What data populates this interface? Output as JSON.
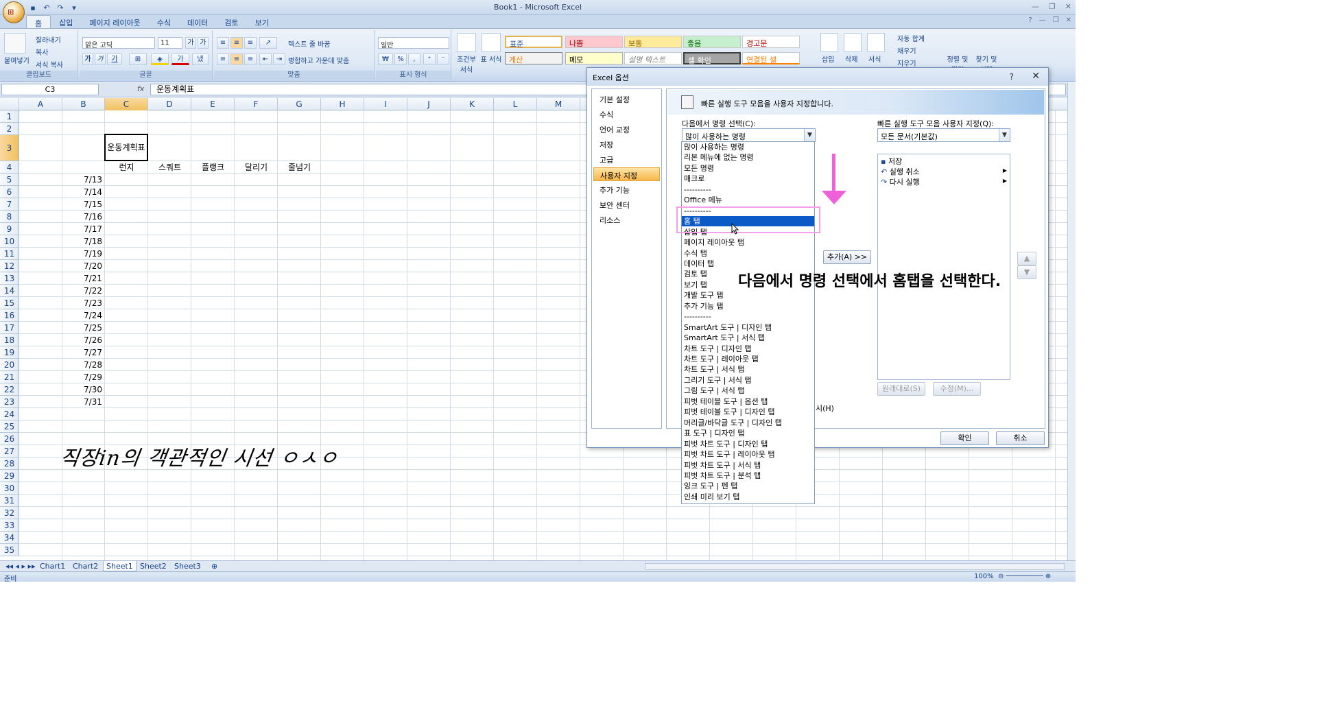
{
  "window": {
    "title": "Book1 - Microsoft Excel"
  },
  "office_button": {
    "label": "Office"
  },
  "ribbon_tabs": [
    "홈",
    "삽입",
    "페이지 레이아웃",
    "수식",
    "데이터",
    "검토",
    "보기"
  ],
  "clipboard": {
    "paste": "붙여넣기",
    "cut": "잘라내기",
    "copy": "복사",
    "format_painter": "서식 복사",
    "label": "클립보드"
  },
  "font": {
    "name": "맑은 고딕",
    "size": "11",
    "label": "글꼴"
  },
  "alignment": {
    "wrap": "텍스트 줄 바꿈",
    "merge": "병합하고 가운데 맞춤",
    "label": "맞춤"
  },
  "number": {
    "format": "일반",
    "label": "표시 형식"
  },
  "styles": {
    "conditional": "조건부 서식",
    "table": "표 서식",
    "cells": [
      "표준",
      "나쁨",
      "보통",
      "좋음",
      "경고문",
      "계산",
      "메모",
      "설명 텍스트",
      "셀 확인",
      "연결된 셀"
    ]
  },
  "cells_group": {
    "insert": "삽입",
    "delete": "삭제",
    "format": "서식"
  },
  "editing": {
    "autosum": "자동 합계",
    "fill": "채우기",
    "clear": "지우기",
    "sort": "정렬 및 필터",
    "find": "찾기 및 선택"
  },
  "formula_bar": {
    "name_box": "C3",
    "fx": "fx",
    "content": "운동계획표"
  },
  "columns": [
    "A",
    "B",
    "C",
    "D",
    "E",
    "F",
    "G",
    "H",
    "I",
    "J",
    "K",
    "L",
    "M"
  ],
  "rows": [
    "1",
    "2",
    "3",
    "4",
    "5",
    "6",
    "7",
    "8",
    "9",
    "10",
    "11",
    "12",
    "13",
    "14",
    "15",
    "16",
    "17",
    "18",
    "19",
    "20",
    "21",
    "22",
    "23",
    "24",
    "25",
    "26",
    "27",
    "28",
    "29",
    "30",
    "31",
    "32",
    "33",
    "34",
    "35"
  ],
  "sheet": {
    "title_cell": "운동계획표",
    "headers": [
      "런지",
      "스쿼트",
      "플랭크",
      "달리기",
      "줄넘기"
    ],
    "dates": [
      "7/13",
      "7/14",
      "7/15",
      "7/16",
      "7/17",
      "7/18",
      "7/19",
      "7/20",
      "7/21",
      "7/22",
      "7/23",
      "7/24",
      "7/25",
      "7/26",
      "7/27",
      "7/28",
      "7/29",
      "7/30",
      "7/31"
    ]
  },
  "sheet_tabs": [
    "Chart1",
    "Chart2",
    "Sheet1",
    "Sheet2",
    "Sheet3"
  ],
  "status": {
    "ready": "준비",
    "zoom": "100%"
  },
  "dialog": {
    "title": "Excel 옵션",
    "help": "?",
    "nav": [
      "기본 설정",
      "수식",
      "언어 교정",
      "저장",
      "고급",
      "사용자 지정",
      "추가 기능",
      "보안 센터",
      "리소스"
    ],
    "header": "빠른 실행 도구 모음을 사용자 지정합니다.",
    "choose_label": "다음에서 명령 선택(C):",
    "choose_value": "많이 사용하는 명령",
    "customize_label": "빠른 실행 도구 모음 사용자 지정(Q):",
    "customize_value": "모든 문서(기본값)",
    "qat_items": [
      "저장",
      "실행 취소",
      "다시 실행"
    ],
    "add_button": "추가(A) >>",
    "reset_button": "원래대로(S)",
    "modify_button": "수정(M)...",
    "show_below": "시(H)",
    "ok": "확인",
    "cancel": "취소"
  },
  "dropdown": {
    "items": [
      "많이 사용하는 명령",
      "리본 메뉴에 없는 명령",
      "모든 명령",
      "매크로",
      "----------",
      "Office 메뉴",
      "----------",
      "홈 탭",
      "삽입 탭",
      "페이지 레이아웃 탭",
      "수식 탭",
      "데이터 탭",
      "검토 탭",
      "보기 탭",
      "개발 도구 탭",
      "추가 기능 탭",
      "----------",
      "SmartArt 도구 | 디자인 탭",
      "SmartArt 도구 | 서식 탭",
      "차트 도구 | 디자인 탭",
      "차트 도구 | 레이아웃 탭",
      "차트 도구 | 서식 탭",
      "그리기 도구 | 서식 탭",
      "그림 도구 | 서식 탭",
      "피벗 테이블 도구 | 옵션 탭",
      "피벗 테이블 도구 | 디자인 탭",
      "머리글/바닥글 도구 | 디자인 탭",
      "표 도구 | 디자인 탭",
      "피벗 차트 도구 | 디자인 탭",
      "피벗 차트 도구 | 레이아웃 탭",
      "피벗 차트 도구 | 서식 탭",
      "피벗 차트 도구 | 분석 탭",
      "잉크 도구 | 펜 탭",
      "인쇄 미리 보기 탭"
    ],
    "selected_index": 7
  },
  "annotation": "다음에서 명령 선택에서 홈탭을 선택한다.",
  "handwriting": "직장in의 객관적인 시선 ㅇㅅㅇ",
  "colors": {
    "highlight": "#0b5ac6",
    "annotation_pink": "#f060d8",
    "ribbon": "#dde8f5"
  }
}
